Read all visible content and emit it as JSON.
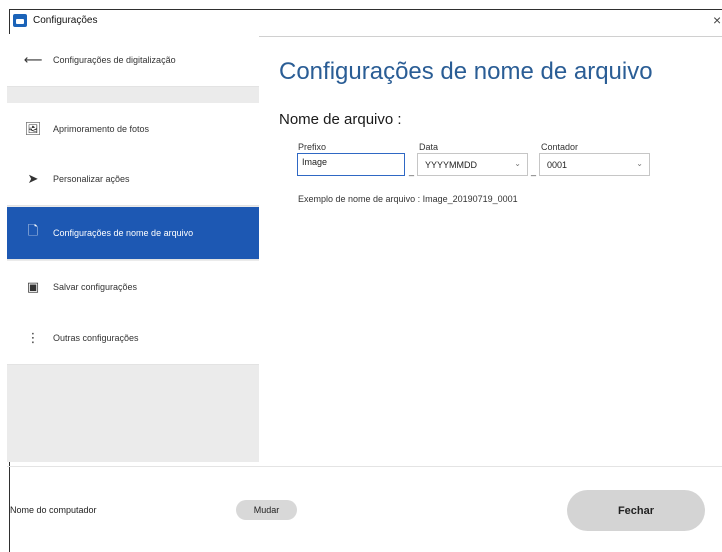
{
  "window": {
    "title": "Configurações",
    "close_glyph": "×"
  },
  "sidebar": {
    "items": [
      {
        "label": "Configurações de digitalização",
        "icon": "scan-arrow-icon",
        "glyph": "⟵",
        "active": false
      },
      {
        "label": "Aprimoramento de fotos",
        "icon": "photo-enhance-icon",
        "glyph": "🖼",
        "active": false
      },
      {
        "label": "Personalizar ações",
        "icon": "send-action-icon",
        "glyph": "➤",
        "active": false
      },
      {
        "label": "Configurações de nome de arquivo",
        "icon": "document-icon",
        "glyph": "🗋",
        "active": true
      },
      {
        "label": "Salvar configurações",
        "icon": "save-folder-icon",
        "glyph": "▣",
        "active": false
      },
      {
        "label": "Outras configurações",
        "icon": "more-vertical-icon",
        "glyph": "⋮",
        "active": false
      }
    ]
  },
  "main": {
    "title": "Configurações de nome de arquivo",
    "section_label": "Nome de arquivo :",
    "prefix": {
      "label": "Prefixo",
      "value": "Image"
    },
    "date": {
      "label": "Data",
      "value": "YYYYMMDD"
    },
    "counter": {
      "label": "Contador",
      "value": "0001"
    },
    "separator": "_",
    "chevron": "⌄",
    "example": "Exemplo de nome de arquivo : Image_20190719_0001"
  },
  "footer": {
    "computer_label": "Nome do computador",
    "change_button": "Mudar",
    "close_button": "Fechar"
  },
  "colors": {
    "accent": "#1d58b3",
    "title": "#2a5d95"
  }
}
